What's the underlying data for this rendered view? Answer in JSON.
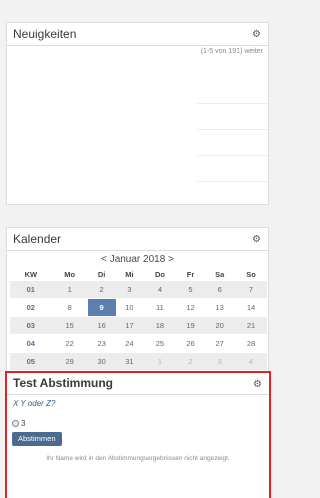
{
  "news": {
    "title": "Neuigkeiten",
    "count_text": "(1-5 von 191)",
    "more_label": "weiter"
  },
  "calendar": {
    "title": "Kalender",
    "prev_label": "<",
    "month_label": "Januar 2018",
    "next_label": ">",
    "headers": [
      "KW",
      "Mo",
      "Di",
      "Mi",
      "Do",
      "Fr",
      "Sa",
      "So"
    ],
    "weeks": [
      {
        "kw": "01",
        "days": [
          "1",
          "2",
          "3",
          "4",
          "5",
          "6",
          "7"
        ]
      },
      {
        "kw": "02",
        "days": [
          "8",
          "9",
          "10",
          "11",
          "12",
          "13",
          "14"
        ]
      },
      {
        "kw": "03",
        "days": [
          "15",
          "16",
          "17",
          "18",
          "19",
          "20",
          "21"
        ]
      },
      {
        "kw": "04",
        "days": [
          "22",
          "23",
          "24",
          "25",
          "26",
          "27",
          "28"
        ]
      },
      {
        "kw": "05",
        "days": [
          "29",
          "30",
          "31",
          "1",
          "2",
          "3",
          "4"
        ]
      }
    ],
    "today": "9",
    "today_color": "#5b7fae"
  },
  "poll": {
    "title": "Test Abstimmung",
    "question": "X Y oder Z?",
    "option_label": "3",
    "vote_label": "Abstimmen",
    "note": "Ihr Name wird in den Abstimmungsergebnissen nicht angezeigt.",
    "highlight_color": "#d9242a"
  },
  "icons": {
    "gear": "⚙"
  }
}
